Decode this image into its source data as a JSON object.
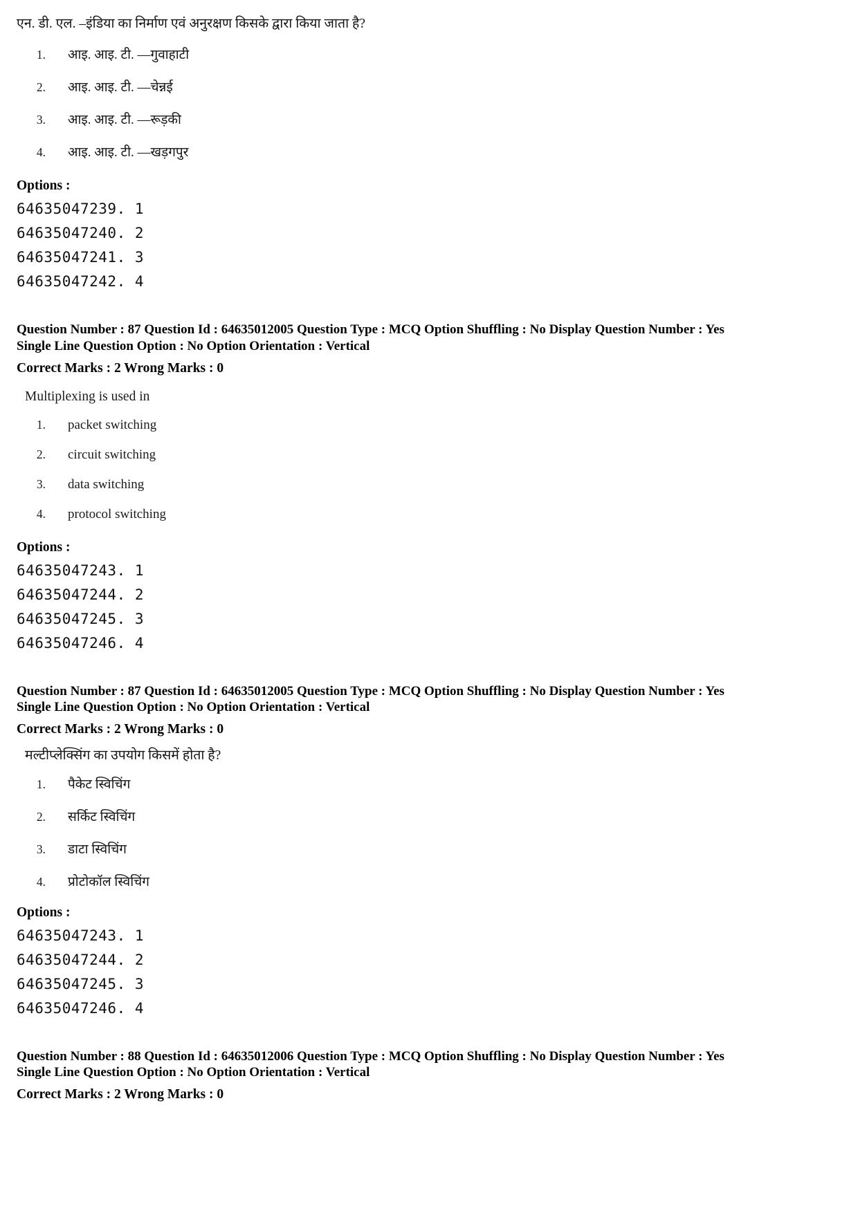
{
  "blocks": [
    {
      "kind": "question_body",
      "language": "hindi",
      "stem": "एन. डी. एल. –इंडिया का निर्माण एवं अनुरक्षण किसके द्वारा किया जाता है?",
      "options": [
        {
          "num": "1.",
          "text": "आइ. आइ. टी. —गुवाहाटी"
        },
        {
          "num": "2.",
          "text": "आइ. आइ. टी. —चेन्नई"
        },
        {
          "num": "3.",
          "text": "आइ. आइ. टी. —रूड़की"
        },
        {
          "num": "4.",
          "text": "आइ. आइ. टी. —खड़गपुर"
        }
      ],
      "options_label": "Options :",
      "option_codes": [
        "64635047239. 1",
        "64635047240. 2",
        "64635047241. 3",
        "64635047242. 4"
      ]
    },
    {
      "kind": "metadata",
      "line1": "Question Number : 87  Question Id : 64635012005  Question Type : MCQ  Option Shuffling : No  Display Question Number : Yes",
      "line2": "Single Line Question Option : No  Option Orientation : Vertical",
      "marks_line": "Correct Marks : 2  Wrong Marks : 0",
      "fields": {
        "question_number_label": "Question Number",
        "question_number": "87",
        "question_id_label": "Question Id",
        "question_id": "64635012005",
        "question_type_label": "Question Type",
        "question_type": "MCQ",
        "option_shuffling_label": "Option Shuffling",
        "option_shuffling": "No",
        "display_question_number_label": "Display Question Number",
        "display_question_number": "Yes",
        "single_line_question_option_label": "Single Line Question Option",
        "single_line_question_option": "No",
        "option_orientation_label": "Option Orientation",
        "option_orientation": "Vertical",
        "correct_marks_label": "Correct Marks",
        "correct_marks": "2",
        "wrong_marks_label": "Wrong Marks",
        "wrong_marks": "0"
      }
    },
    {
      "kind": "question_body",
      "language": "english",
      "stem": "Multiplexing  is used in",
      "options": [
        {
          "num": "1.",
          "text": "packet switching"
        },
        {
          "num": "2.",
          "text": "circuit switching"
        },
        {
          "num": "3.",
          "text": "data switching"
        },
        {
          "num": "4.",
          "text": "protocol switching"
        }
      ],
      "options_label": "Options :",
      "option_codes": [
        "64635047243. 1",
        "64635047244. 2",
        "64635047245. 3",
        "64635047246. 4"
      ]
    },
    {
      "kind": "metadata",
      "line1": "Question Number : 87  Question Id : 64635012005  Question Type : MCQ  Option Shuffling : No  Display Question Number : Yes",
      "line2": "Single Line Question Option : No  Option Orientation : Vertical",
      "marks_line": "Correct Marks : 2  Wrong Marks : 0",
      "fields": {
        "question_number_label": "Question Number",
        "question_number": "87",
        "question_id_label": "Question Id",
        "question_id": "64635012005",
        "question_type_label": "Question Type",
        "question_type": "MCQ",
        "option_shuffling_label": "Option Shuffling",
        "option_shuffling": "No",
        "display_question_number_label": "Display Question Number",
        "display_question_number": "Yes",
        "single_line_question_option_label": "Single Line Question Option",
        "single_line_question_option": "No",
        "option_orientation_label": "Option Orientation",
        "option_orientation": "Vertical",
        "correct_marks_label": "Correct Marks",
        "correct_marks": "2",
        "wrong_marks_label": "Wrong Marks",
        "wrong_marks": "0"
      }
    },
    {
      "kind": "question_body",
      "language": "hindi",
      "stem": "मल्टीप्लेक्सिंग का उपयोग किसमें होता है?",
      "options": [
        {
          "num": "1.",
          "text": "पैकेट स्विचिंग"
        },
        {
          "num": "2.",
          "text": "सर्किट स्विचिंग"
        },
        {
          "num": "3.",
          "text": "डाटा स्विचिंग"
        },
        {
          "num": "4.",
          "text": "प्रोटोकॉल स्विचिंग"
        }
      ],
      "options_label": "Options :",
      "option_codes": [
        "64635047243. 1",
        "64635047244. 2",
        "64635047245. 3",
        "64635047246. 4"
      ]
    },
    {
      "kind": "metadata",
      "line1": "Question Number : 88  Question Id : 64635012006  Question Type : MCQ  Option Shuffling : No  Display Question Number : Yes",
      "line2": "Single Line Question Option : No  Option Orientation : Vertical",
      "marks_line": "Correct Marks : 2  Wrong Marks : 0",
      "fields": {
        "question_number_label": "Question Number",
        "question_number": "88",
        "question_id_label": "Question Id",
        "question_id": "64635012006",
        "question_type_label": "Question Type",
        "question_type": "MCQ",
        "option_shuffling_label": "Option Shuffling",
        "option_shuffling": "No",
        "display_question_number_label": "Display Question Number",
        "display_question_number": "Yes",
        "single_line_question_option_label": "Single Line Question Option",
        "single_line_question_option": "No",
        "option_orientation_label": "Option Orientation",
        "option_orientation": "Vertical",
        "correct_marks_label": "Correct Marks",
        "correct_marks": "2",
        "wrong_marks_label": "Wrong Marks",
        "wrong_marks": "0"
      }
    }
  ]
}
